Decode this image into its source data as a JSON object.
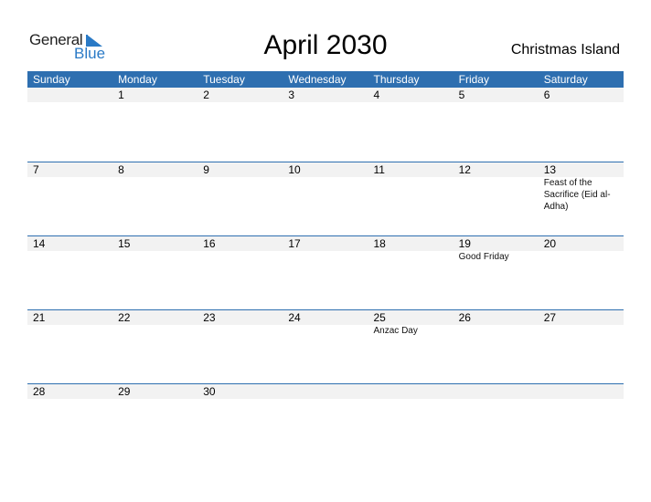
{
  "logo": {
    "general": "General",
    "blue": "Blue"
  },
  "title": "April 2030",
  "region": "Christmas Island",
  "weekdays": [
    "Sunday",
    "Monday",
    "Tuesday",
    "Wednesday",
    "Thursday",
    "Friday",
    "Saturday"
  ],
  "weeks": [
    {
      "days": [
        "",
        "1",
        "2",
        "3",
        "4",
        "5",
        "6"
      ],
      "events": [
        "",
        "",
        "",
        "",
        "",
        "",
        ""
      ]
    },
    {
      "days": [
        "7",
        "8",
        "9",
        "10",
        "11",
        "12",
        "13"
      ],
      "events": [
        "",
        "",
        "",
        "",
        "",
        "",
        "Feast of the Sacrifice (Eid al-Adha)"
      ]
    },
    {
      "days": [
        "14",
        "15",
        "16",
        "17",
        "18",
        "19",
        "20"
      ],
      "events": [
        "",
        "",
        "",
        "",
        "",
        "Good Friday",
        ""
      ]
    },
    {
      "days": [
        "21",
        "22",
        "23",
        "24",
        "25",
        "26",
        "27"
      ],
      "events": [
        "",
        "",
        "",
        "",
        "Anzac Day",
        "",
        ""
      ]
    },
    {
      "days": [
        "28",
        "29",
        "30",
        "",
        "",
        "",
        ""
      ],
      "events": [
        "",
        "",
        "",
        "",
        "",
        "",
        ""
      ]
    }
  ]
}
